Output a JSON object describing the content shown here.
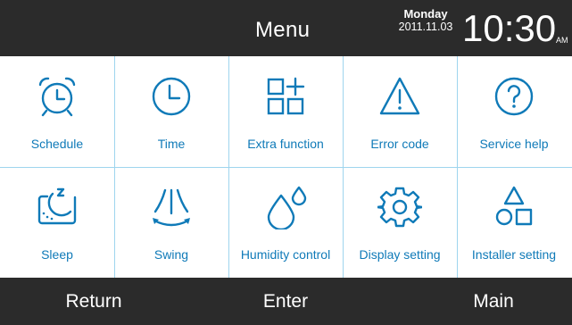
{
  "header": {
    "title": "Menu",
    "day": "Monday",
    "date": "2011.11.03",
    "time": "10:30",
    "ampm": "AM"
  },
  "menu": [
    {
      "label": "Schedule",
      "icon": "alarm-clock-icon"
    },
    {
      "label": "Time",
      "icon": "clock-icon"
    },
    {
      "label": "Extra function",
      "icon": "grid-plus-icon"
    },
    {
      "label": "Error code",
      "icon": "warning-icon"
    },
    {
      "label": "Service help",
      "icon": "question-icon"
    },
    {
      "label": "Sleep",
      "icon": "moon-zz-icon"
    },
    {
      "label": "Swing",
      "icon": "airflow-icon"
    },
    {
      "label": "Humidity control",
      "icon": "droplet-icon"
    },
    {
      "label": "Display setting",
      "icon": "gear-icon"
    },
    {
      "label": "Installer setting",
      "icon": "shapes-icon"
    }
  ],
  "footer": {
    "return_label": "Return",
    "enter_label": "Enter",
    "main_label": "Main"
  },
  "colors": {
    "accent": "#0f7ab8",
    "divider": "#9ed5ee",
    "bar": "#2b2b2b"
  }
}
